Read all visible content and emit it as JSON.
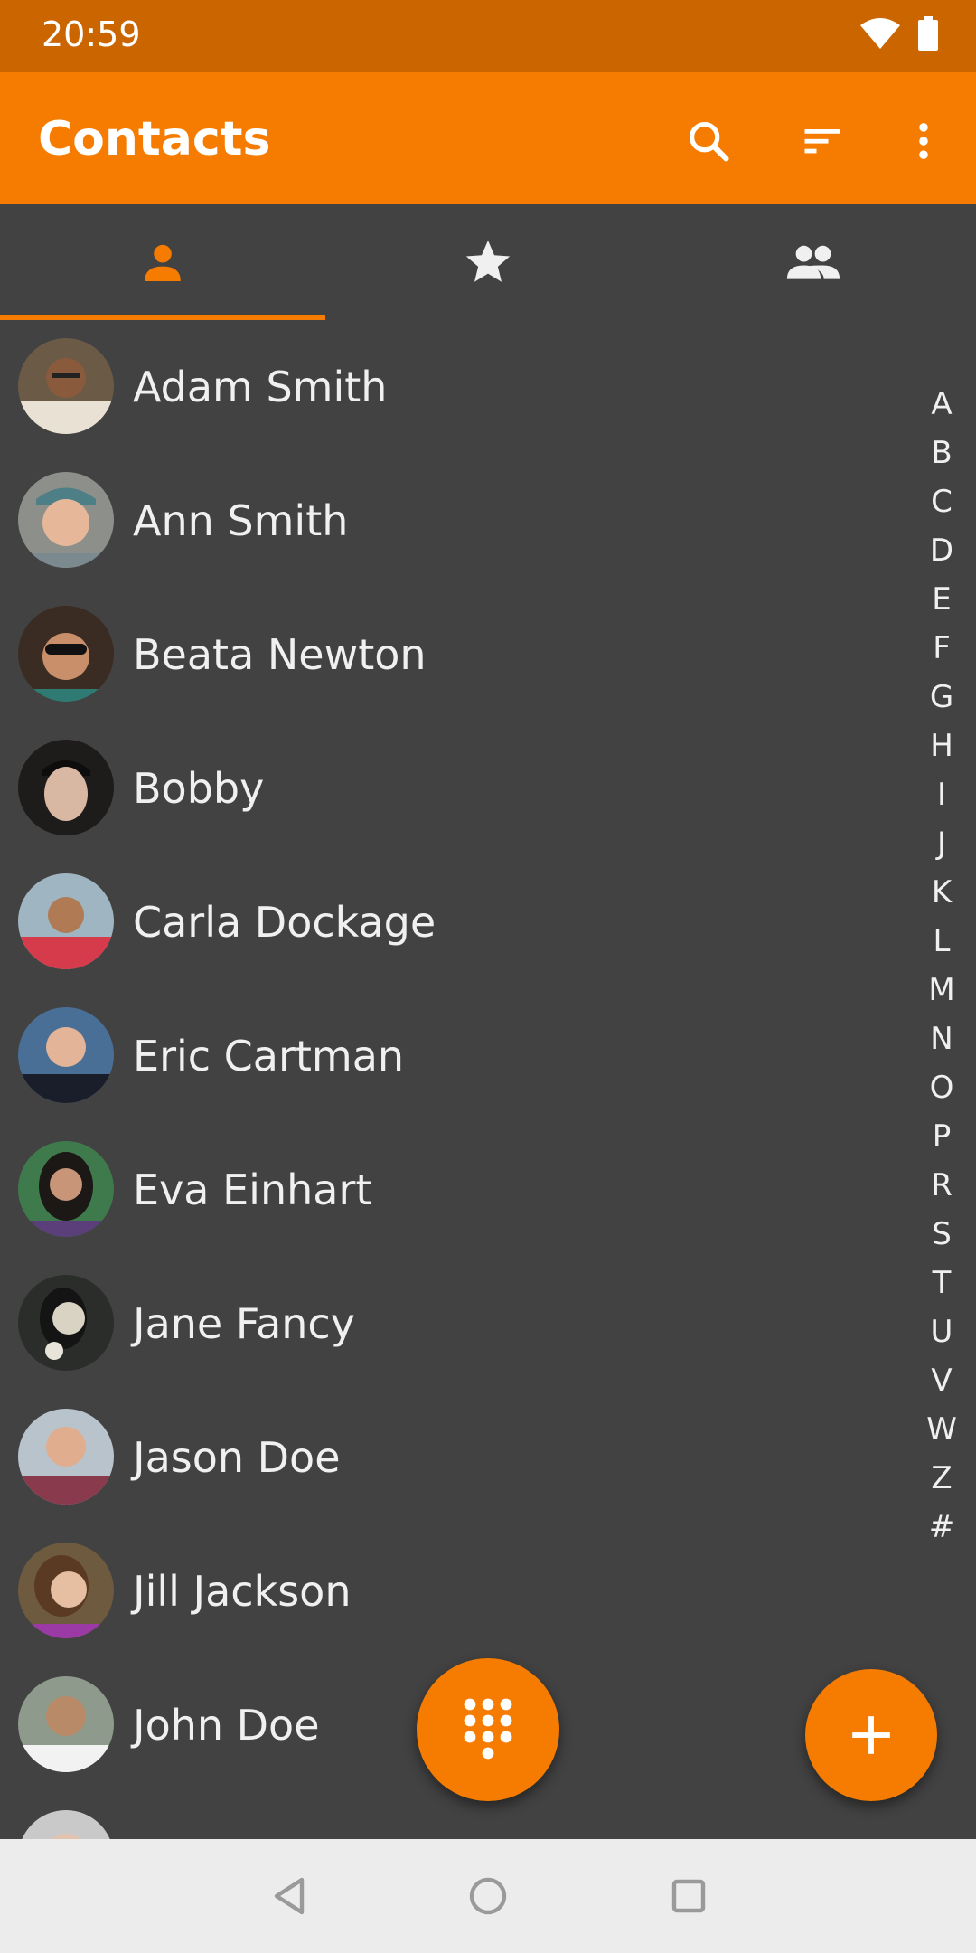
{
  "status_bar": {
    "time": "20:59",
    "icons": [
      "wifi-icon",
      "battery-icon"
    ]
  },
  "app_bar": {
    "title": "Contacts",
    "actions": [
      "search-icon",
      "sort-icon",
      "more-vert-icon"
    ]
  },
  "tabs": [
    {
      "icon": "person-icon",
      "active": true
    },
    {
      "icon": "star-icon",
      "active": false
    },
    {
      "icon": "group-icon",
      "active": false
    }
  ],
  "contacts": [
    {
      "name": "Adam Smith"
    },
    {
      "name": "Ann Smith"
    },
    {
      "name": "Beata Newton"
    },
    {
      "name": "Bobby"
    },
    {
      "name": "Carla Dockage"
    },
    {
      "name": "Eric Cartman"
    },
    {
      "name": "Eva Einhart"
    },
    {
      "name": "Jane Fancy"
    },
    {
      "name": "Jason Doe"
    },
    {
      "name": "Jill Jackson"
    },
    {
      "name": "John Doe"
    }
  ],
  "alphabet": [
    "A",
    "B",
    "C",
    "D",
    "E",
    "F",
    "G",
    "H",
    "I",
    "J",
    "K",
    "L",
    "M",
    "N",
    "O",
    "P",
    "R",
    "S",
    "T",
    "U",
    "V",
    "W",
    "Z",
    "#"
  ],
  "fabs": {
    "dialpad_icon": "dialpad-icon",
    "add_icon": "plus-icon"
  },
  "nav_bar": [
    "back-icon",
    "home-icon",
    "recents-icon"
  ],
  "colors": {
    "accent": "#f57c00",
    "status_bar": "#cb6500",
    "background": "#424242",
    "text": "#f0f0f0"
  }
}
